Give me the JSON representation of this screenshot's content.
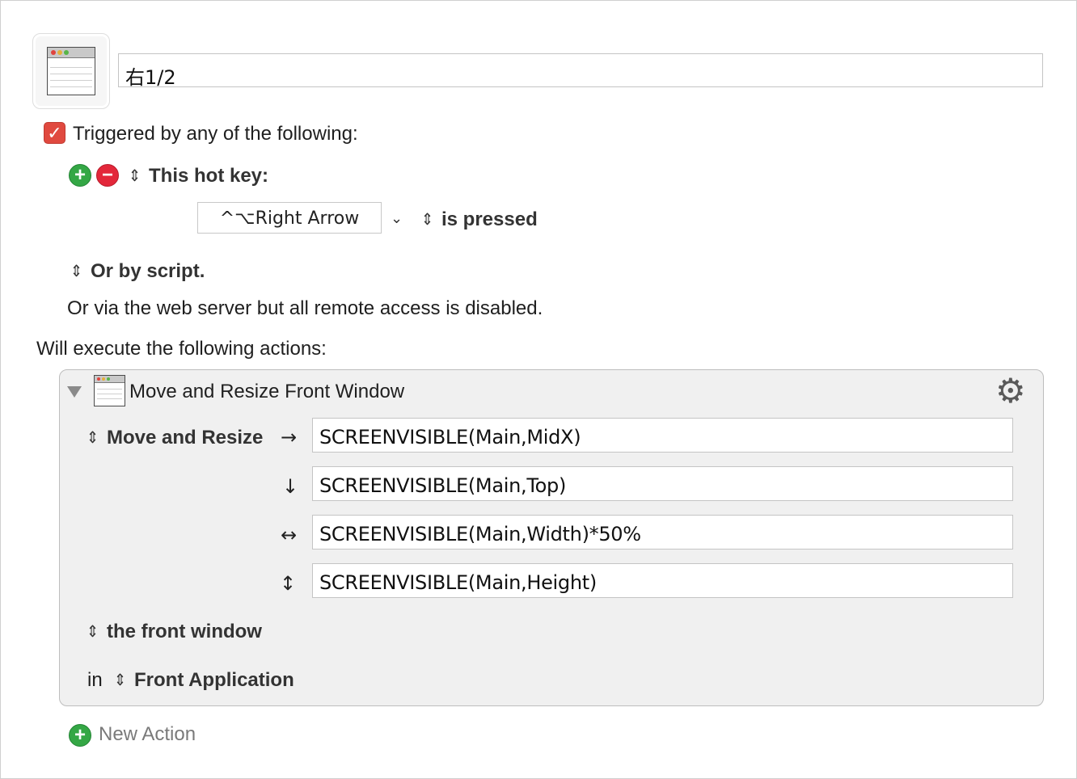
{
  "macro": {
    "name": "右1/2",
    "icon": "window-icon"
  },
  "triggers": {
    "enabled": true,
    "header": "Triggered by any of the following:",
    "hotkey_label": "This hot key:",
    "hotkey_value": "^⌥Right Arrow",
    "hotkey_condition": "is pressed",
    "script_label": "Or by script.",
    "web_server_text": "Or via the web server but all remote access is disabled."
  },
  "actions": {
    "header": "Will execute the following actions:",
    "items": [
      {
        "title": "Move and Resize Front Window",
        "icon": "window-icon",
        "mode": "Move and Resize",
        "fields": [
          {
            "arrow": "→",
            "value": "SCREENVISIBLE(Main,MidX)"
          },
          {
            "arrow": "↓",
            "value": "SCREENVISIBLE(Main,Top)"
          },
          {
            "arrow": "↔",
            "value": "SCREENVISIBLE(Main,Width)*50%"
          },
          {
            "arrow": "↕",
            "value": "SCREENVISIBLE(Main,Height)"
          }
        ],
        "target_window": "the front window",
        "in_label": "in",
        "target_app": "Front Application"
      }
    ],
    "new_action_label": "New Action"
  },
  "colors": {
    "checkbox": "#e0493f",
    "add_button": "#34a745",
    "remove_button": "#e3273a",
    "action_background": "#f0f0f0"
  }
}
